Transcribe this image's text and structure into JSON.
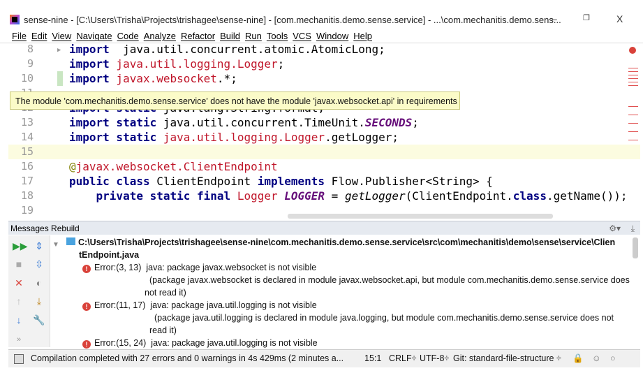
{
  "window": {
    "title": "sense-nine - [C:\\Users\\Trisha\\Projects\\trishagee\\sense-nine] - [com.mechanitis.demo.sense.service] - ...\\com.mechanitis.demo.sens...",
    "minimize": "–",
    "restore": "❐",
    "close": "X"
  },
  "menu": [
    "File",
    "Edit",
    "View",
    "Navigate",
    "Code",
    "Analyze",
    "Refactor",
    "Build",
    "Run",
    "Tools",
    "VCS",
    "Window",
    "Help"
  ],
  "editor": {
    "lines": [
      {
        "n": "8",
        "parts": [
          [
            "kw",
            "import"
          ],
          [
            "",
            "  java.util.concurrent.atomic.AtomicLong;"
          ]
        ]
      },
      {
        "n": "9",
        "parts": [
          [
            "kw",
            "import"
          ],
          [
            "pk",
            " java.util.logging.Logger"
          ],
          [
            "",
            ";"
          ]
        ]
      },
      {
        "n": "10",
        "parts": [
          [
            "kw",
            "import"
          ],
          [
            "pk",
            " javax.websocket"
          ],
          [
            "",
            ".*;"
          ]
        ]
      },
      {
        "n": "11",
        "parts": []
      },
      {
        "n": "12",
        "parts": [
          [
            "kw",
            "import static"
          ],
          [
            "",
            " java.lang.String.format;"
          ]
        ]
      },
      {
        "n": "13",
        "parts": [
          [
            "kw",
            "import static"
          ],
          [
            "",
            " java.util.concurrent.TimeUnit."
          ],
          [
            "const",
            "SECONDS"
          ],
          [
            "",
            ";"
          ]
        ]
      },
      {
        "n": "14",
        "parts": [
          [
            "kw",
            "import static"
          ],
          [
            "pk",
            " java.util.logging.Logger"
          ],
          [
            "",
            ".getLogger;"
          ]
        ]
      },
      {
        "n": "15",
        "parts": []
      },
      {
        "n": "16",
        "parts": [
          [
            "ann",
            "@"
          ],
          [
            "pk",
            "javax.websocket.ClientEndpoint"
          ]
        ]
      },
      {
        "n": "17",
        "parts": [
          [
            "kw",
            "public class"
          ],
          [
            "",
            " ClientEndpoint "
          ],
          [
            "kw",
            "implements"
          ],
          [
            "",
            " Flow.Publisher<String> {"
          ]
        ]
      },
      {
        "n": "18",
        "parts": [
          [
            "",
            "    "
          ],
          [
            "kw",
            "private static final"
          ],
          [
            "pk",
            " Logger "
          ],
          [
            "const",
            "LOGGER"
          ],
          [
            "",
            " = "
          ],
          [
            "it",
            "getLogger"
          ],
          [
            "",
            "(ClientEndpoint."
          ],
          [
            "kw",
            "class"
          ],
          [
            "",
            ".getName());"
          ]
        ]
      },
      {
        "n": "19",
        "parts": []
      }
    ],
    "tooltip": "The module 'com.mechanitis.demo.sense.service' does not have the module 'javax.websocket.api' in requirements"
  },
  "messages": {
    "header": "Messages Rebuild",
    "file_line1": "C:\\Users\\Trisha\\Projects\\trishagee\\sense-nine\\com.mechanitis.demo.sense.service\\src\\com\\mechanitis\\demo\\sense\\service\\Clien",
    "file_line2": "tEndpoint.java",
    "errors": [
      {
        "loc": "Error:(3, 13)",
        "msg": "java: package javax.websocket is not visible",
        "detail1": "(package javax.websocket is declared in module javax.websocket.api, but module com.mechanitis.demo.sense.service does",
        "detail2": "not read it)"
      },
      {
        "loc": "Error:(11, 17)",
        "msg": "java: package java.util.logging is not visible",
        "detail1": "(package java.util.logging is declared in module java.logging, but module com.mechanitis.demo.sense.service does not",
        "detail2": "read it)"
      },
      {
        "loc": "Error:(15, 24)",
        "msg": "java: package java.util.logging is not visible"
      }
    ]
  },
  "status": {
    "text": "Compilation completed with 27 errors and 0 warnings in 4s 429ms (2 minutes a...",
    "position": "15:1",
    "line_sep": "CRLF÷",
    "encoding": "UTF-8÷",
    "vcs": "Git: standard-file-structure ÷"
  }
}
